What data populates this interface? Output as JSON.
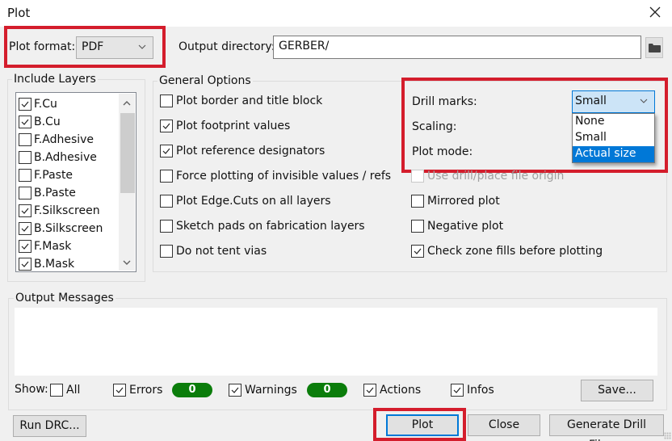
{
  "window": {
    "title": "Plot",
    "close_icon": "close-x-icon"
  },
  "top": {
    "plot_format_label": "Plot format:",
    "plot_format_value": "PDF",
    "output_dir_label": "Output directory:",
    "output_dir_value": "GERBER/",
    "browse_icon": "folder-icon"
  },
  "include_layers": {
    "title": "Include Layers",
    "items": [
      {
        "label": "F.Cu",
        "checked": true
      },
      {
        "label": "B.Cu",
        "checked": true
      },
      {
        "label": "F.Adhesive",
        "checked": false
      },
      {
        "label": "B.Adhesive",
        "checked": false
      },
      {
        "label": "F.Paste",
        "checked": false
      },
      {
        "label": "B.Paste",
        "checked": false
      },
      {
        "label": "F.Silkscreen",
        "checked": true
      },
      {
        "label": "B.Silkscreen",
        "checked": true
      },
      {
        "label": "F.Mask",
        "checked": true
      },
      {
        "label": "B.Mask",
        "checked": true
      }
    ]
  },
  "general_options": {
    "title": "General Options",
    "left": [
      {
        "label": "Plot border and title block",
        "checked": false
      },
      {
        "label": "Plot footprint values",
        "checked": true
      },
      {
        "label": "Plot reference designators",
        "checked": true
      },
      {
        "label": "Force plotting of invisible values / refs",
        "checked": false
      },
      {
        "label": "Plot Edge.Cuts on all layers",
        "checked": false
      },
      {
        "label": "Sketch pads on fabrication layers",
        "checked": false
      },
      {
        "label": "Do not tent vias",
        "checked": false
      }
    ],
    "drill_marks_label": "Drill marks:",
    "drill_marks_value": "Small",
    "drill_marks_options": [
      "None",
      "Small",
      "Actual size"
    ],
    "drill_marks_highlighted": "Actual size",
    "scaling_label": "Scaling:",
    "plot_mode_label": "Plot mode:",
    "right": [
      {
        "label": "Use drill/place file origin",
        "checked": false,
        "disabled": true
      },
      {
        "label": "Mirrored plot",
        "checked": false
      },
      {
        "label": "Negative plot",
        "checked": false
      },
      {
        "label": "Check zone fills before plotting",
        "checked": true
      }
    ]
  },
  "output_messages": {
    "title": "Output Messages",
    "show_label": "Show:",
    "filters": [
      {
        "label": "All",
        "checked": false
      },
      {
        "label": "Errors",
        "checked": true,
        "count": "0"
      },
      {
        "label": "Warnings",
        "checked": true,
        "count": "0"
      },
      {
        "label": "Actions",
        "checked": true
      },
      {
        "label": "Infos",
        "checked": true
      }
    ],
    "save_label": "Save..."
  },
  "buttons": {
    "run_drc": "Run DRC...",
    "plot": "Plot",
    "close": "Close",
    "generate_drill": "Generate Drill Files..."
  },
  "colors": {
    "highlight_red": "#d41d2c",
    "accent_blue": "#0078d7",
    "badge_green": "#0b7d0b"
  }
}
